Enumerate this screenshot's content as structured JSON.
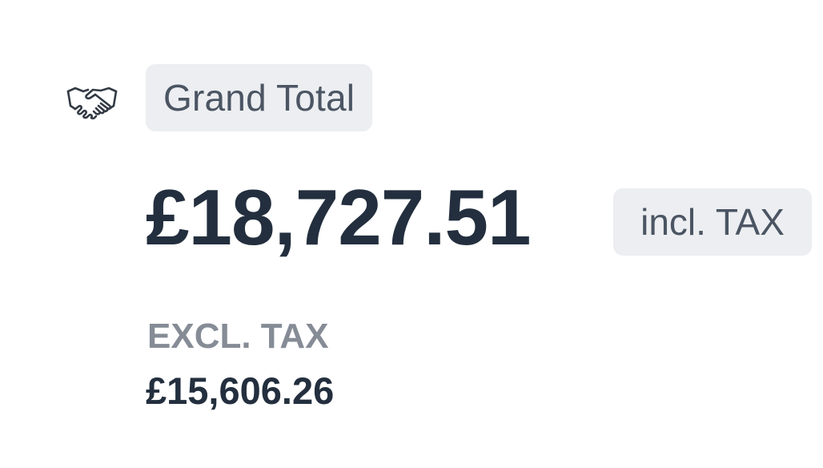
{
  "summary": {
    "icon": "handshake-icon",
    "title": "Grand Total",
    "grand_total": "£18,727.51",
    "tax_note": "incl. TAX",
    "excl_label": "EXCL. TAX",
    "excl_amount": "£15,606.26"
  },
  "colors": {
    "text_primary": "#232f3e",
    "text_muted": "#868c96",
    "badge_bg": "#eceef1"
  }
}
